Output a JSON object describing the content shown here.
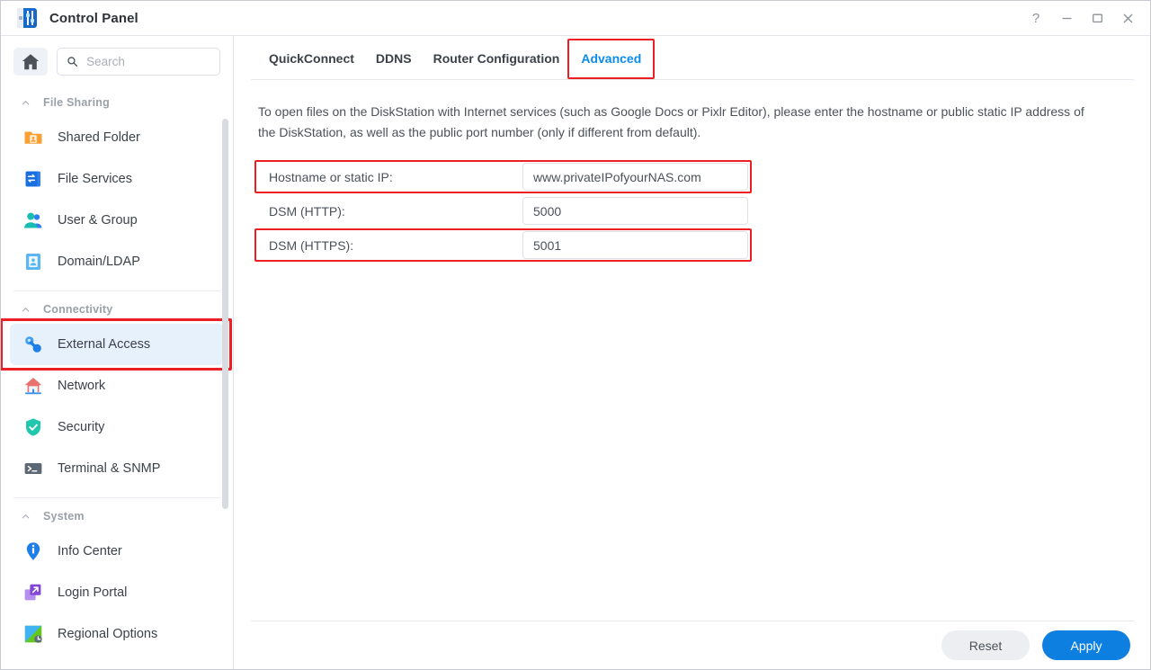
{
  "window": {
    "title": "Control Panel",
    "app_icon": "control-panel-icon",
    "controls": {
      "help": "?",
      "minimize": "minimize-icon",
      "maximize": "maximize-icon",
      "close": "close-icon"
    }
  },
  "sidebar": {
    "home_icon": "home-icon",
    "search": {
      "placeholder": "Search",
      "value": "",
      "icon": "search-icon"
    },
    "groups": [
      {
        "title": "File Sharing",
        "collapse_icon": "chevron-up-icon",
        "items": [
          {
            "label": "Shared Folder",
            "icon": "shared-folder-icon"
          },
          {
            "label": "File Services",
            "icon": "file-services-icon"
          },
          {
            "label": "User & Group",
            "icon": "user-group-icon"
          },
          {
            "label": "Domain/LDAP",
            "icon": "domain-ldap-icon"
          }
        ]
      },
      {
        "title": "Connectivity",
        "collapse_icon": "chevron-up-icon",
        "items": [
          {
            "label": "External Access",
            "icon": "external-access-icon",
            "active": true,
            "highlighted": true
          },
          {
            "label": "Network",
            "icon": "network-icon"
          },
          {
            "label": "Security",
            "icon": "security-icon"
          },
          {
            "label": "Terminal & SNMP",
            "icon": "terminal-snmp-icon"
          }
        ]
      },
      {
        "title": "System",
        "collapse_icon": "chevron-up-icon",
        "items": [
          {
            "label": "Info Center",
            "icon": "info-center-icon"
          },
          {
            "label": "Login Portal",
            "icon": "login-portal-icon"
          },
          {
            "label": "Regional Options",
            "icon": "regional-options-icon"
          }
        ]
      }
    ]
  },
  "main": {
    "tabs": [
      {
        "label": "QuickConnect",
        "active": false,
        "highlighted": false
      },
      {
        "label": "DDNS",
        "active": false,
        "highlighted": false
      },
      {
        "label": "Router Configuration",
        "active": false,
        "highlighted": false
      },
      {
        "label": "Advanced",
        "active": true,
        "highlighted": true
      }
    ],
    "description": "To open files on the DiskStation with Internet services (such as Google Docs or Pixlr Editor), please enter the hostname or public static IP address of the DiskStation, as well as the public port number (only if different from default).",
    "fields": [
      {
        "label": "Hostname or static IP:",
        "value": "www.privateIPofyourNAS.com",
        "highlighted": true
      },
      {
        "label": "DSM (HTTP):",
        "value": "5000",
        "highlighted": false
      },
      {
        "label": "DSM (HTTPS):",
        "value": "5001",
        "highlighted": true
      }
    ],
    "footer": {
      "reset_label": "Reset",
      "apply_label": "Apply"
    }
  },
  "colors": {
    "accent": "#0c8ce9",
    "apply_button": "#0c7fe0",
    "highlight_box": "#ec2024",
    "active_row": "#e6f1fc"
  }
}
